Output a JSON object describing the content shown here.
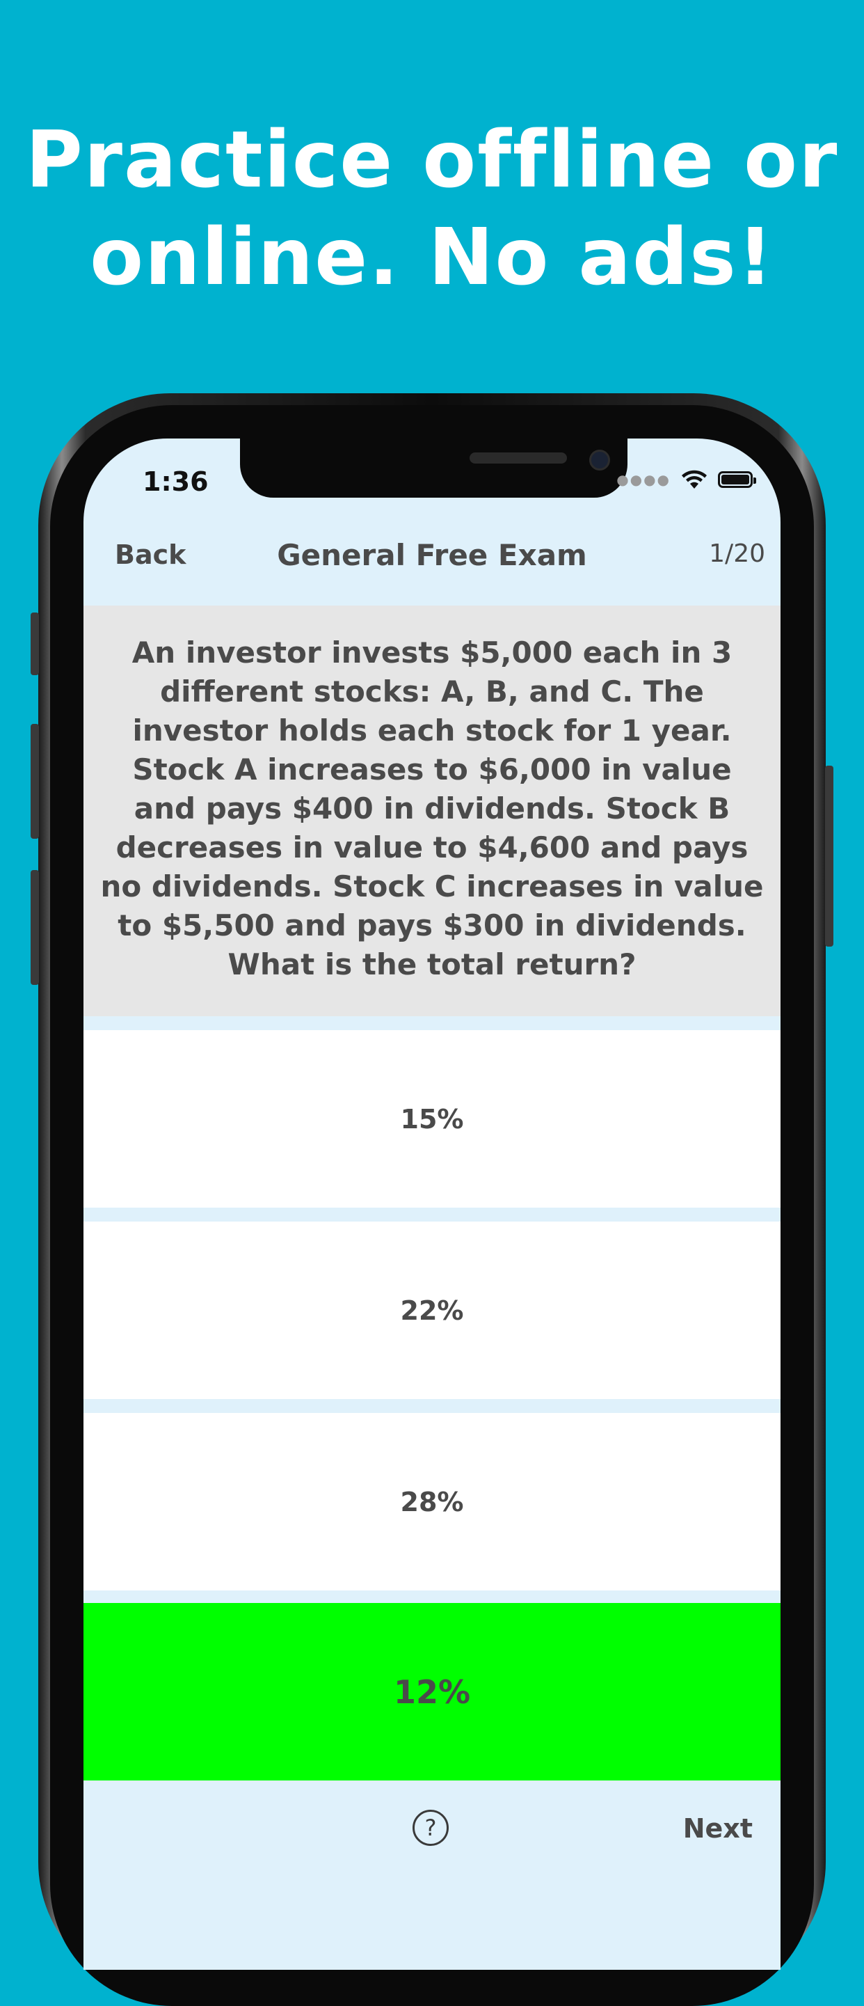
{
  "promo": {
    "line1": "Practice offline or",
    "line2": "online. No ads!"
  },
  "status_bar": {
    "time": "1:36",
    "icons": [
      "cellular-dots-icon",
      "wifi-icon",
      "battery-icon"
    ]
  },
  "nav": {
    "back_label": "Back",
    "title": "General Free Exam",
    "progress": "1/20"
  },
  "question": {
    "text": "An investor invests $5,000 each in 3 different stocks: A, B, and C. The investor holds each stock for 1 year. Stock A increases to $6,000 in value and pays $400 in dividends. Stock B decreases in value to $4,600 and pays no dividends. Stock C increases in value to $5,500 and pays $300 in dividends. What is the total return?"
  },
  "answers": [
    {
      "label": "15%",
      "correct": false
    },
    {
      "label": "22%",
      "correct": false
    },
    {
      "label": "28%",
      "correct": false
    },
    {
      "label": "12%",
      "correct": true
    }
  ],
  "bottom": {
    "help_glyph": "?",
    "next_label": "Next"
  },
  "colors": {
    "background": "#00b2cf",
    "screen_bg": "#dff1fb",
    "question_bg": "#e6e6e6",
    "correct": "#00ff00",
    "text": "#4a4a4a"
  }
}
